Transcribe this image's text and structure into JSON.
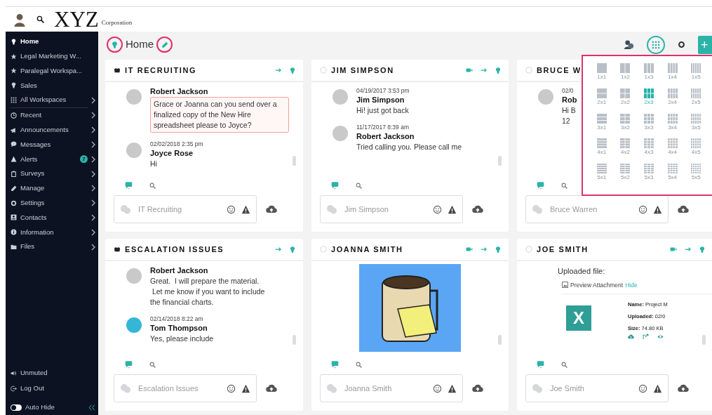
{
  "header": {
    "logo": "XYZ",
    "logo_suffix": "Corporation"
  },
  "sidebar": {
    "items": [
      {
        "label": "Home",
        "selected": true,
        "submenu": false
      },
      {
        "label": "Legal Marketing W...",
        "selected": false,
        "submenu": false
      },
      {
        "label": "Paralegal Workspa...",
        "selected": false,
        "submenu": false
      },
      {
        "label": "Sales",
        "selected": false,
        "submenu": false
      },
      {
        "label": "All Workspaces",
        "selected": false,
        "submenu": true
      },
      {
        "label": "Recent",
        "selected": false,
        "submenu": true,
        "separator_above": true
      },
      {
        "label": "Announcements",
        "selected": false,
        "submenu": true
      },
      {
        "label": "Messages",
        "selected": false,
        "submenu": true
      },
      {
        "label": "Alerts",
        "selected": false,
        "submenu": true,
        "badge": "7"
      },
      {
        "label": "Surveys",
        "selected": false,
        "submenu": true
      },
      {
        "label": "Manage",
        "selected": false,
        "submenu": true
      },
      {
        "label": "Settings",
        "selected": false,
        "submenu": true
      },
      {
        "label": "Contacts",
        "selected": false,
        "submenu": true
      },
      {
        "label": "Information",
        "selected": false,
        "submenu": true
      },
      {
        "label": "Files",
        "selected": false,
        "submenu": true
      }
    ],
    "footer": [
      {
        "label": "Unmuted"
      },
      {
        "label": "Log Out"
      }
    ],
    "auto_hide": {
      "label": "Auto Hide",
      "on": false
    }
  },
  "page": {
    "title": "Home",
    "add_button": "+"
  },
  "layout_picker": {
    "options": [
      {
        "label": "1x1",
        "selected": false
      },
      {
        "label": "1x2",
        "selected": false
      },
      {
        "label": "1x3",
        "selected": false
      },
      {
        "label": "1x4",
        "selected": false
      },
      {
        "label": "1x5",
        "selected": false
      },
      {
        "label": "2x1",
        "selected": false
      },
      {
        "label": "2x2",
        "selected": false
      },
      {
        "label": "2x3",
        "selected": true
      },
      {
        "label": "2x4",
        "selected": false
      },
      {
        "label": "2x5",
        "selected": false
      },
      {
        "label": "3x1",
        "selected": false
      },
      {
        "label": "3x2",
        "selected": false
      },
      {
        "label": "3x3",
        "selected": false
      },
      {
        "label": "3x4",
        "selected": false
      },
      {
        "label": "3x5",
        "selected": false
      },
      {
        "label": "4x1",
        "selected": false
      },
      {
        "label": "4x2",
        "selected": false
      },
      {
        "label": "4x3",
        "selected": false
      },
      {
        "label": "4x4",
        "selected": false
      },
      {
        "label": "4x5",
        "selected": false
      },
      {
        "label": "5x1",
        "selected": false
      },
      {
        "label": "5x2",
        "selected": false
      },
      {
        "label": "5x3",
        "selected": false
      },
      {
        "label": "5x4",
        "selected": false
      },
      {
        "label": "5x5",
        "selected": false
      }
    ]
  },
  "cards": [
    {
      "kind": "group",
      "title": "IT RECRUITING",
      "placeholder": "IT Recruiting",
      "messages": [
        {
          "kind": "text",
          "author": "Robert Jackson",
          "lines": [
            "Grace or Joanna can you send over a finalized copy of the New Hire spreadsheet please to Joyce?"
          ],
          "highlighted": true
        },
        {
          "kind": "text",
          "time": "02/02/2018 2:35 pm",
          "author": "Joyce Rose",
          "lines": [
            "Hi"
          ],
          "highlighted": false
        }
      ]
    },
    {
      "kind": "person",
      "title": "JIM SIMPSON",
      "placeholder": "Jim Simpson",
      "messages": [
        {
          "kind": "text",
          "time": "04/19/2017 3:53 pm",
          "author": "Jim Simpson",
          "lines": [
            "Hi! just got back"
          ],
          "highlighted": false
        },
        {
          "kind": "text",
          "time": "11/17/2017 8:39 am",
          "author": "Robert Jackson",
          "lines": [
            "Tried calling you. Please call me"
          ],
          "highlighted": false
        }
      ]
    },
    {
      "kind": "person",
      "title": "BRUCE W",
      "covered_by_picker": true,
      "placeholder": "Bruce Warren",
      "messages": [
        {
          "kind": "text",
          "time": "02/0",
          "author": "Rob",
          "lines": [
            "Hi B",
            "12"
          ],
          "highlighted": false
        }
      ]
    },
    {
      "kind": "group",
      "title": "ESCALATION ISSUES",
      "placeholder": "Escalation Issues",
      "messages": [
        {
          "kind": "text",
          "author": "Robert Jackson",
          "lines": [
            "Great.  I will prepare the material.",
            " Let me know if you want to include",
            "the financial charts."
          ],
          "highlighted": false
        },
        {
          "kind": "text",
          "color": "#35b6d6",
          "time": "02/14/2018 8:22 am",
          "author": "Tom Thompson",
          "lines": [
            "Yes, please include"
          ],
          "highlighted": false
        }
      ]
    },
    {
      "kind": "person",
      "title": "JOANNA SMITH",
      "placeholder": "Joanna Smith",
      "messages": [
        {
          "kind": "image"
        }
      ]
    },
    {
      "kind": "person",
      "title": "JOE SMITH",
      "placeholder": "Joe Smith",
      "messages": [
        {
          "kind": "file",
          "caption": "Uploaded file:",
          "link_label": "Preview Attachment",
          "toggle_label": "Hide",
          "file_letter": "X",
          "details": [
            {
              "key": "Name:",
              "value": "Project M"
            },
            {
              "key": "Uploaded:",
              "value": "02/0"
            },
            {
              "key": "Size:",
              "value": "74.80 KB"
            }
          ]
        }
      ]
    }
  ]
}
